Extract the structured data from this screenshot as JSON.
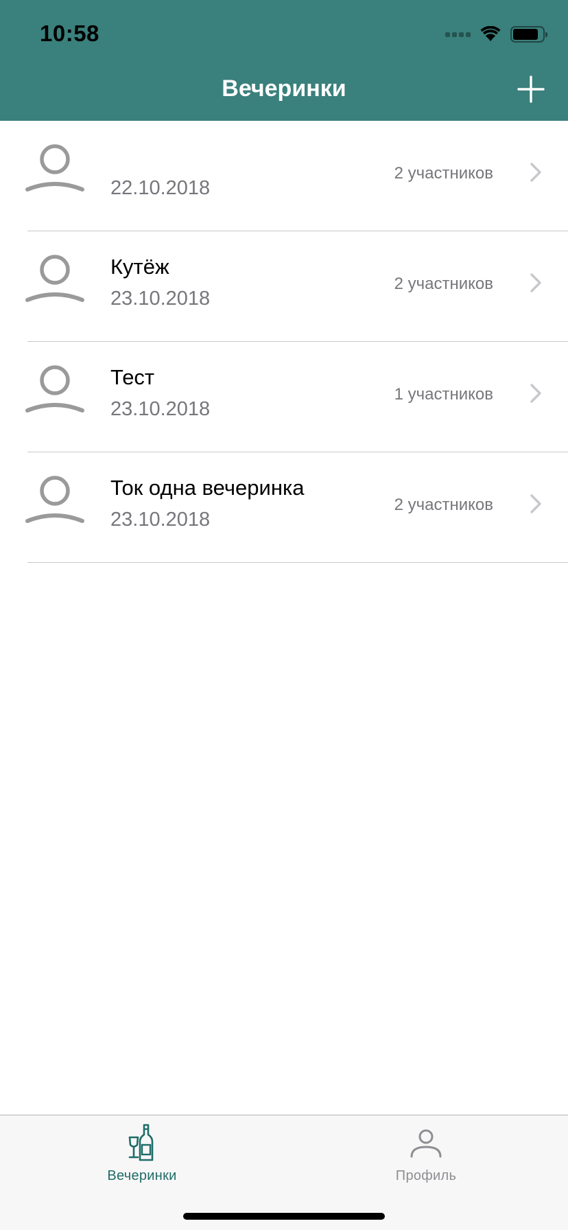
{
  "status_bar": {
    "time": "10:58"
  },
  "nav": {
    "title": "Вечеринки",
    "add_icon": "plus-icon"
  },
  "colors": {
    "header": "#3a807c",
    "accent": "#1f6c68",
    "secondary_text": "#76767b"
  },
  "parties": [
    {
      "name": "",
      "date": "22.10.2018",
      "participants": "2 участников"
    },
    {
      "name": "Кутёж",
      "date": "23.10.2018",
      "participants": "2 участников"
    },
    {
      "name": "Тест",
      "date": "23.10.2018",
      "participants": "1 участников"
    },
    {
      "name": "Ток одна вечеринка",
      "date": "23.10.2018",
      "participants": "2 участников"
    }
  ],
  "tab_bar": {
    "tabs": [
      {
        "label": "Вечеринки",
        "icon": "party-bottles-icon",
        "selected": true
      },
      {
        "label": "Профиль",
        "icon": "profile-icon",
        "selected": false
      }
    ]
  }
}
